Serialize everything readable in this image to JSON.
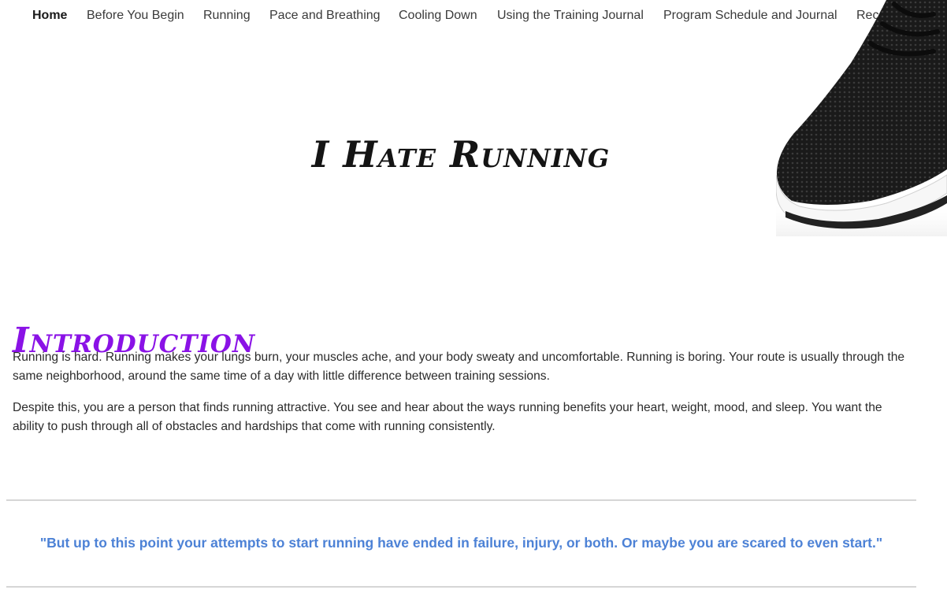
{
  "nav": {
    "items": [
      {
        "label": "Home",
        "active": true
      },
      {
        "label": "Before You Begin"
      },
      {
        "label": "Running"
      },
      {
        "label": "Pace and Breathing"
      },
      {
        "label": "Cooling Down"
      },
      {
        "label": "Using the Training Journal"
      },
      {
        "label": "Program Schedule and Journal"
      },
      {
        "label": "Recommended Apps"
      }
    ]
  },
  "hero": {
    "title": "I Hate Running",
    "image_icon": "running-shoe-image"
  },
  "intro": {
    "heading": "Introduction",
    "paragraphs": [
      "Running is hard. Running makes your lungs burn, your muscles ache, and your body sweaty and uncomfortable. Running is boring. Your route is usually through the same neighborhood, around the same time of a  day with little difference between training sessions.",
      "Despite this, you are a person that finds running attractive. You see and hear about the ways running benefits your heart, weight, mood, and sleep. You want the ability to push through all of obstacles and hardships that come with running consistently."
    ]
  },
  "quote": {
    "text": "\"But up to this point your attempts to start running have ended in failure, injury, or both. Or maybe you are scared to even start.\""
  },
  "colors": {
    "heading_accent": "#8a12e6",
    "quote_text": "#4d82d6",
    "rule": "#d6d6d6"
  }
}
